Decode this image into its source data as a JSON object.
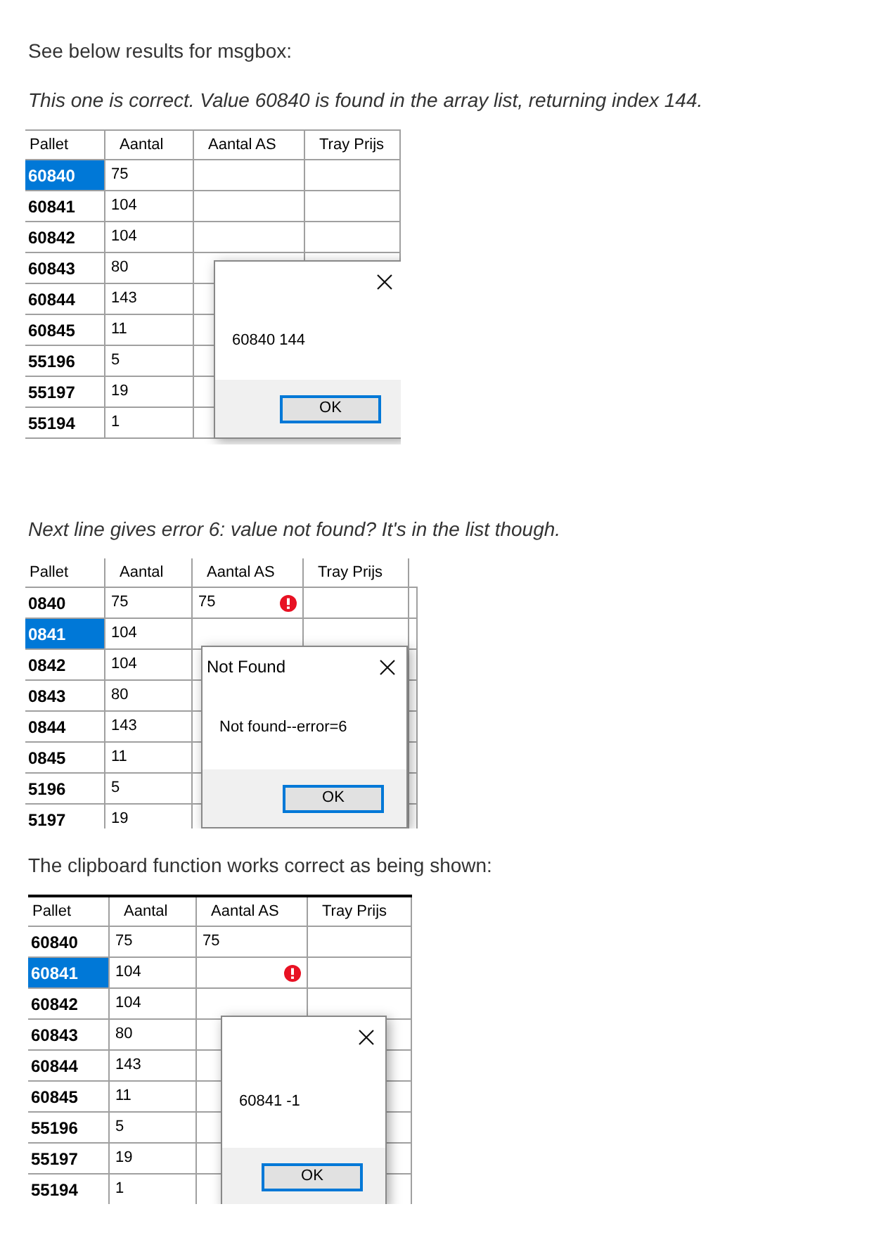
{
  "blocks": [
    {
      "kind": "text",
      "text": "See below results for msgbox:"
    },
    {
      "kind": "note",
      "text": "This one is correct. Value 60840 is found in the array list, returning index 144."
    },
    {
      "kind": "grid",
      "columns": [
        "Pallet",
        "Aantal",
        "Aantal AS",
        "Tray Prijs"
      ],
      "rows": [
        {
          "cells": [
            "60840",
            "75",
            "",
            ""
          ],
          "selected": true,
          "error": false
        },
        {
          "cells": [
            "60841",
            "104",
            "",
            ""
          ],
          "selected": false,
          "error": false
        },
        {
          "cells": [
            "60842",
            "104",
            "",
            ""
          ],
          "selected": false,
          "error": false
        },
        {
          "cells": [
            "60843",
            "80",
            "",
            ""
          ],
          "selected": false
        },
        {
          "cells": [
            "60844",
            "143",
            "",
            ""
          ],
          "selected": false
        },
        {
          "cells": [
            "60845",
            "11",
            "",
            ""
          ],
          "selected": false
        },
        {
          "cells": [
            "55196",
            "5",
            "",
            ""
          ],
          "selected": false
        },
        {
          "cells": [
            "55197",
            "19",
            "",
            ""
          ],
          "selected": false
        },
        {
          "cells": [
            "55194",
            "1",
            "",
            ""
          ],
          "selected": false
        }
      ],
      "dialog": {
        "message": "60840 144",
        "button": "OK"
      }
    },
    {
      "kind": "note",
      "text": "Next line gives error 6: value not found? It's in the list though."
    },
    {
      "kind": "grid",
      "columns": [
        "Pallet",
        "Aantal",
        "Aantal AS",
        "Tray Prijs"
      ],
      "rows": [
        {
          "cells": [
            "0840",
            "75",
            "75",
            ""
          ],
          "selected": false,
          "error": true
        },
        {
          "cells": [
            "0841",
            "104",
            "",
            ""
          ],
          "selected": true,
          "error": false
        },
        {
          "cells": [
            "0842",
            "104",
            "",
            ""
          ],
          "selected": false
        },
        {
          "cells": [
            "0843",
            "80",
            "",
            ""
          ],
          "selected": false
        },
        {
          "cells": [
            "0844",
            "143",
            "",
            ""
          ],
          "selected": false
        },
        {
          "cells": [
            "0845",
            "11",
            "",
            ""
          ],
          "selected": false
        },
        {
          "cells": [
            "5196",
            "5",
            "",
            ""
          ],
          "selected": false
        },
        {
          "cells": [
            "5197",
            "19",
            "",
            ""
          ],
          "selected": false
        }
      ],
      "dialog": {
        "title": "Not Found",
        "message": "Not found--error=6",
        "button": "OK"
      }
    },
    {
      "kind": "text",
      "text": "The clipboard function works correct as being shown:"
    },
    {
      "kind": "grid",
      "columns": [
        "Pallet",
        "Aantal",
        "Aantal AS",
        "Tray Prijs"
      ],
      "rows": [
        {
          "cells": [
            "60840",
            "75",
            "75",
            ""
          ],
          "selected": false,
          "error": false
        },
        {
          "cells": [
            "60841",
            "104",
            "",
            ""
          ],
          "selected": true,
          "error": true
        },
        {
          "cells": [
            "60842",
            "104",
            "",
            ""
          ],
          "selected": false,
          "error": false
        },
        {
          "cells": [
            "60843",
            "80",
            "",
            ""
          ],
          "selected": false
        },
        {
          "cells": [
            "60844",
            "143",
            "",
            ""
          ],
          "selected": false
        },
        {
          "cells": [
            "60845",
            "11",
            "",
            ""
          ],
          "selected": false
        },
        {
          "cells": [
            "55196",
            "5",
            "",
            ""
          ],
          "selected": false
        },
        {
          "cells": [
            "55197",
            "19",
            "",
            ""
          ],
          "selected": false
        },
        {
          "cells": [
            "55194",
            "1",
            "",
            ""
          ],
          "selected": false
        }
      ],
      "dialog": {
        "message": "60841 -1",
        "button": "OK"
      }
    }
  ]
}
